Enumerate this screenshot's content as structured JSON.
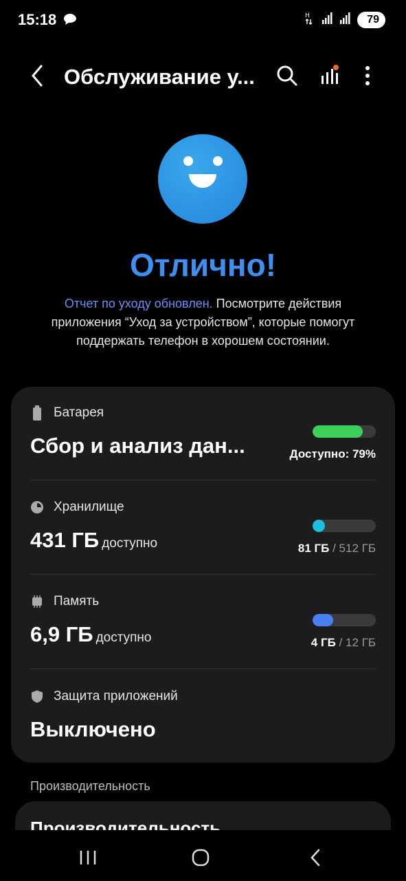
{
  "status_bar": {
    "time": "15:18",
    "battery": "79"
  },
  "header": {
    "title": "Обслуживание у..."
  },
  "status": {
    "title": "Отлично!"
  },
  "description": {
    "link": "Отчет по уходу обновлен.",
    "text": " Посмотрите действия приложения “Уход за устройством”, которые помогут поддержать телефон в хорошем состоянии."
  },
  "battery": {
    "label": "Батарея",
    "value": "Сбор и анализ дан...",
    "caption": "Доступно: 79%",
    "level": 0.79,
    "color": "#3ccf5a"
  },
  "storage": {
    "label": "Хранилище",
    "value": "431 ГБ",
    "value_sub": "доступно",
    "used": "81 ГБ",
    "separator": " / ",
    "total": "512 ГБ",
    "level": 0.16,
    "color": "#1ec0e0"
  },
  "memory": {
    "label": "Память",
    "value": "6,9 ГБ",
    "value_sub": "доступно",
    "used": "4 ГБ",
    "separator": " / ",
    "total": "12 ГБ",
    "level": 0.33,
    "color": "#4a7ff2"
  },
  "protection": {
    "label": "Защита приложений",
    "value": "Выключено"
  },
  "performance": {
    "section_label": "Производительность",
    "card_title": "Производительность"
  },
  "icons": {
    "back": "back-arrow-icon",
    "search": "search-icon",
    "chart": "bar-chart-icon",
    "more": "more-vertical-icon",
    "battery": "battery-icon",
    "storage": "storage-pie-icon",
    "memory": "memory-chip-icon",
    "shield": "shield-icon"
  }
}
